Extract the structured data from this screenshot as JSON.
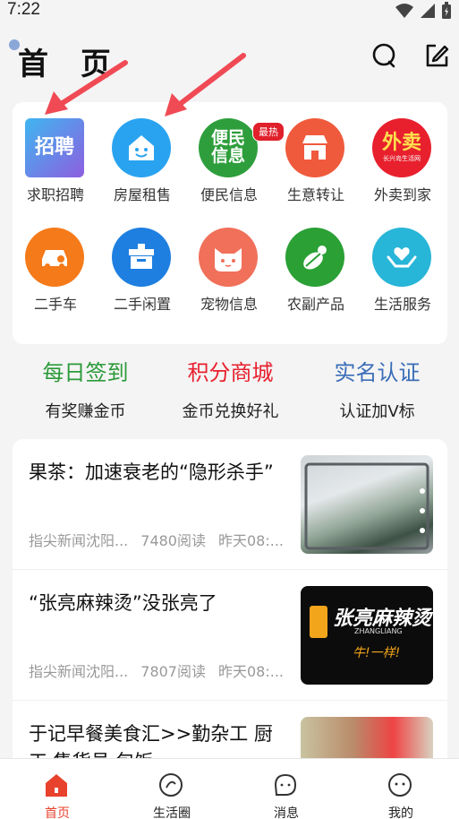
{
  "status_bar": {
    "time": "7:22"
  },
  "header": {
    "title": "首 页"
  },
  "grid": {
    "items": [
      {
        "label": "求职招聘",
        "icon_text": "招聘",
        "icon": "recruit-icon",
        "color": "#6c7de8"
      },
      {
        "label": "房屋租售",
        "icon": "house-icon",
        "color": "#29a3f0"
      },
      {
        "label": "便民信息",
        "icon_text_1": "便民",
        "icon_text_2": "信息",
        "icon": "info-icon",
        "color": "#2e9e3c",
        "badge": "最热"
      },
      {
        "label": "生意转让",
        "icon": "shop-icon",
        "color": "#f05a3c"
      },
      {
        "label": "外卖到家",
        "icon_text": "外卖",
        "icon_sub": "长兴岛生活网",
        "icon": "takeout-icon",
        "color": "#e8202e"
      },
      {
        "label": "二手车",
        "icon": "car-icon",
        "color": "#f57a1a"
      },
      {
        "label": "二手闲置",
        "icon": "box-icon",
        "color": "#1e7fe0"
      },
      {
        "label": "宠物信息",
        "icon": "cat-icon",
        "color": "#f0705a"
      },
      {
        "label": "农副产品",
        "icon": "vegetable-icon",
        "color": "#2aa035"
      },
      {
        "label": "生活服务",
        "icon": "care-hands-icon",
        "color": "#27b5d8"
      }
    ]
  },
  "quick": [
    {
      "title": "每日签到",
      "sub": "有奖赚金币",
      "color": "#2c9a3a"
    },
    {
      "title": "积分商城",
      "sub": "金币兑换好礼",
      "color": "#e8202e"
    },
    {
      "title": "实名认证",
      "sub": "认证加V标",
      "color": "#3a6db8"
    }
  ],
  "news": [
    {
      "title": "果茶：加速衰老的“隐形杀手”",
      "source": "指尖新闻沈阳...",
      "reads": "7480阅读",
      "time": "昨天08:..."
    },
    {
      "title": "“张亮麻辣烫”没张亮了",
      "source": "指尖新闻沈阳...",
      "reads": "7807阅读",
      "time": "昨天08:...",
      "thumb_text": "张亮麻辣烫",
      "thumb_sub": "ZHANGLIANG",
      "thumb_slogan": "牛!一样!"
    },
    {
      "title": "于记早餐美食汇>>勤杂工 厨工 售货员 包饭",
      "source": "",
      "reads": "",
      "time": ""
    }
  ],
  "tabs": [
    {
      "label": "首页",
      "icon": "home-icon",
      "active": true
    },
    {
      "label": "生活圈",
      "icon": "life-circle-icon",
      "active": false
    },
    {
      "label": "消息",
      "icon": "message-icon",
      "active": false
    },
    {
      "label": "我的",
      "icon": "profile-icon",
      "active": false
    }
  ]
}
